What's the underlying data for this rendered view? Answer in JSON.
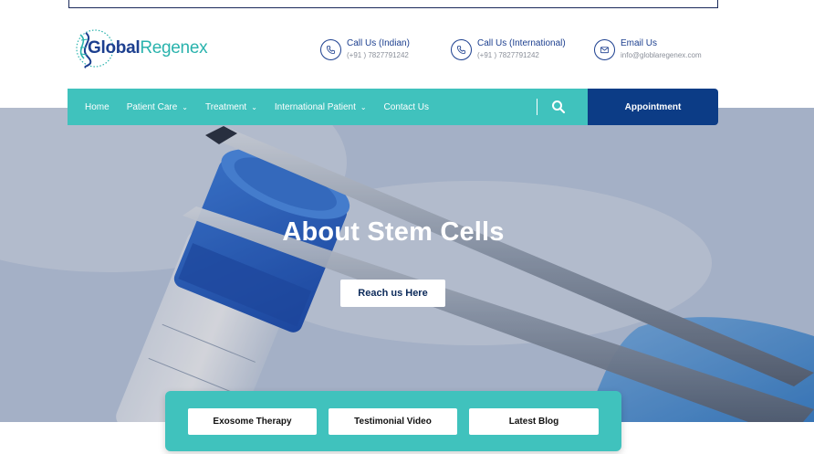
{
  "brand": {
    "name_part1": "Global",
    "name_part2": "Regenex",
    "color_primary": "#1c3f8f",
    "color_accent": "#2ab3ad"
  },
  "contacts": [
    {
      "icon": "phone-icon",
      "label": "Call Us (Indian)",
      "value": "(+91 ) 7827791242"
    },
    {
      "icon": "phone-icon",
      "label": "Call Us (International)",
      "value": "(+91 ) 7827791242"
    },
    {
      "icon": "mail-icon",
      "label": "Email Us",
      "value": "info@globlaregenex.com"
    }
  ],
  "nav": {
    "items": [
      {
        "label": "Home",
        "has_dropdown": false
      },
      {
        "label": "Patient Care",
        "has_dropdown": true
      },
      {
        "label": "Treatment",
        "has_dropdown": true
      },
      {
        "label": "International Patient",
        "has_dropdown": true
      },
      {
        "label": "Contact Us",
        "has_dropdown": false
      }
    ],
    "search_icon": "search-icon",
    "appointment_label": "Appointment",
    "color_bar": "#40c2bd",
    "color_appointment": "#0c3c86"
  },
  "hero": {
    "title": "About Stem Cells",
    "button_label": "Reach us Here"
  },
  "quick_links": [
    {
      "label": "Exosome Therapy"
    },
    {
      "label": "Testimonial Video"
    },
    {
      "label": "Latest Blog"
    }
  ]
}
